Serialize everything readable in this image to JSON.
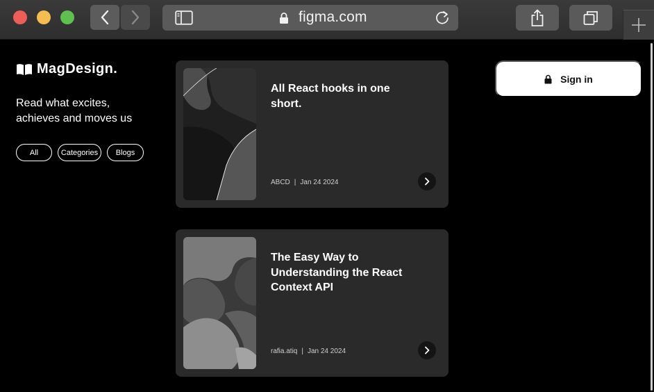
{
  "browser": {
    "url": "figma.com",
    "icons": {
      "back": "chevron-left-icon",
      "forward": "chevron-right-icon",
      "sidebar": "sidebar-icon",
      "lock": "lock-icon",
      "reload": "reload-icon",
      "share": "share-icon",
      "tabs": "tabs-overview-icon",
      "new_tab": "plus-icon"
    },
    "colors": {
      "close": "#ee5e57",
      "minimize": "#f5bd4f",
      "zoom": "#5ec04d"
    }
  },
  "brand": {
    "name": "MagDesign.",
    "icon": "open-book-icon"
  },
  "tagline": "Read what excites, achieves and moves us",
  "filters": [
    "All",
    "Categories",
    "Blogs"
  ],
  "auth": {
    "sign_in_label": "Sign in",
    "icon": "lock-icon"
  },
  "articles": [
    {
      "title": "All React hooks in one short.",
      "author": "ABCD",
      "separator": "|",
      "date": "Jan 24 2024"
    },
    {
      "title": "The Easy Way to Understanding the React Context API",
      "author": "rafia.atiq",
      "separator": "|",
      "date": "Jan 24 2024"
    }
  ],
  "theme": {
    "background": "#000000",
    "card": "#2a2a2a",
    "text": "#ffffff"
  }
}
